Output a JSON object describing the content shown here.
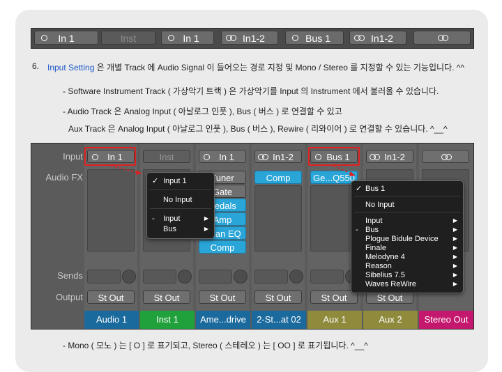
{
  "top_strip": {
    "buttons": [
      {
        "label": "In 1",
        "icon": "mono"
      },
      {
        "label": "Inst",
        "icon": "none"
      },
      {
        "label": "In 1",
        "icon": "mono"
      },
      {
        "label": "In1-2",
        "icon": "stereo"
      },
      {
        "label": "Bus 1",
        "icon": "mono"
      },
      {
        "label": "In1-2",
        "icon": "stereo"
      },
      {
        "label": "",
        "icon": "stereo"
      }
    ]
  },
  "doc": {
    "item_number": "6.",
    "item_link": "Input Setting",
    "item_text": " 은 개별 Track 에 Audio Signal 이 들어오는 경로 지정 및 Mono / Stereo 를 지정할 수 있는 기능입니다. ^^",
    "bullet1": "- Software Instrument Track ( 가상악기 트랙 ) 은 가상악기를 Input 의 Instrument 에서 불러올 수 있습니다.",
    "bullet2a": "- Audio Track 은 Analog Input ( 아날로그 인풋 ), Bus ( 버스 ) 로 연결할 수 있고",
    "bullet2b": "Aux Track 은 Analog Input ( 아날로그 인풋 ), Bus ( 버스 ), Rewire ( 리와이어 ) 로 연결할 수 있습니다. ^__^",
    "bullet3": "- Mono ( 모노 ) 는 [ O ] 로 표기되고, Stereo ( 스테레오 ) 는 [ OO ] 로 표기됩니다. ^__^"
  },
  "mixer": {
    "row_labels": {
      "input": "Input",
      "audio_fx": "Audio FX",
      "sends": "Sends",
      "output": "Output"
    },
    "channels": [
      {
        "input": "In 1",
        "icon": "mono",
        "output": "St Out",
        "name": "Audio 1",
        "color": "#1b6a9e",
        "plugins": []
      },
      {
        "input": "Inst",
        "icon": "none",
        "output": "St Out",
        "name": "Inst 1",
        "color": "#21a13c",
        "plugins": []
      },
      {
        "input": "In 1",
        "icon": "mono",
        "output": "St Out",
        "name": "Ame...drive",
        "color": "#1b6a9e",
        "plugins": [
          "Tuner",
          "Gate",
          "Pedals",
          "Amp",
          "Chan EQ",
          "Comp"
        ]
      },
      {
        "input": "In1-2",
        "icon": "stereo",
        "output": "St Out",
        "name": "2-St...at 02",
        "color": "#1b6a9e",
        "plugins": [
          "Comp"
        ]
      },
      {
        "input": "Bus 1",
        "icon": "mono",
        "output": "St Out",
        "name": "Aux 1",
        "color": "#8f8a3c",
        "plugins": [
          "Ge...Q550"
        ]
      },
      {
        "input": "In1-2",
        "icon": "stereo",
        "output": "St Out",
        "name": "Aux 2",
        "color": "#8f8a3c",
        "plugins": []
      },
      {
        "input": "",
        "icon": "stereo",
        "output": "",
        "name": "Stereo Out",
        "color": "#c4176e",
        "plugins": []
      }
    ]
  },
  "menu_input": {
    "items": [
      {
        "label": "Input 1",
        "check": "✓",
        "arrow": ""
      },
      {
        "label": "No Input",
        "check": "",
        "arrow": ""
      },
      {
        "label": "Input",
        "check": "-",
        "arrow": "▶"
      },
      {
        "label": "Bus",
        "check": "",
        "arrow": "▶"
      }
    ]
  },
  "menu_bus": {
    "items": [
      {
        "label": "Bus 1",
        "check": "✓",
        "arrow": ""
      },
      {
        "label": "No Input",
        "check": "",
        "arrow": ""
      },
      {
        "label": "Input",
        "check": "",
        "arrow": "▶"
      },
      {
        "label": "Bus",
        "check": "-",
        "arrow": "▶"
      },
      {
        "label": "Plogue Bidule Device",
        "check": "",
        "arrow": "▶"
      },
      {
        "label": "Finale",
        "check": "",
        "arrow": "▶"
      },
      {
        "label": "Melodyne 4",
        "check": "",
        "arrow": "▶"
      },
      {
        "label": "Reason",
        "check": "",
        "arrow": "▶"
      },
      {
        "label": "Sibelius 7.5",
        "check": "",
        "arrow": "▶"
      },
      {
        "label": "Waves ReWire",
        "check": "",
        "arrow": "▶"
      }
    ]
  },
  "colors": {
    "link": "#1a57c8",
    "plugin": "#29a5d8",
    "highlight": "#e02020"
  }
}
